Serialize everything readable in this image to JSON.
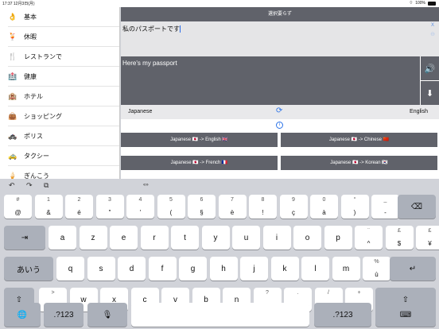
{
  "status": {
    "time": "17:37",
    "date": "12月3日(月)",
    "battery": "100%"
  },
  "sidebar": {
    "items": [
      {
        "icon": "👌",
        "label": "基本"
      },
      {
        "icon": "🍹",
        "label": "休暇"
      },
      {
        "icon": "🍴",
        "label": "レストランで"
      },
      {
        "icon": "🏥",
        "label": "健康"
      },
      {
        "icon": "🏨",
        "label": "ホテル"
      },
      {
        "icon": "👜",
        "label": "ショッピング"
      },
      {
        "icon": "🚓",
        "label": "ポリス"
      },
      {
        "icon": "🚕",
        "label": "タクシー"
      },
      {
        "icon": "🍦",
        "label": "ぎんこう"
      }
    ]
  },
  "main": {
    "title": "選択要らず",
    "input_text": "私のパスポートです",
    "input_close": "X",
    "output_text": "Here's my passport",
    "source_lang": "Japanese",
    "target_lang": "English",
    "pairs": [
      "Japanese 🇯🇵 -> English 🇬🇧",
      "Japanese 🇯🇵 -> Chinese 🇨🇳",
      "Japanese 🇯🇵 -> French 🇫🇷",
      "Japanese 🇯🇵 -> Korean 🇰🇷"
    ]
  },
  "keyboard": {
    "toolbar": {
      "undo": "↶",
      "redo": "↷",
      "paste": "⧉",
      "candidates": "«»"
    },
    "row1": [
      {
        "top": "#",
        "bot": "@"
      },
      {
        "top": "1",
        "bot": "&"
      },
      {
        "top": "2",
        "bot": "é"
      },
      {
        "top": "3",
        "bot": "\""
      },
      {
        "top": "4",
        "bot": "'"
      },
      {
        "top": "5",
        "bot": "("
      },
      {
        "top": "6",
        "bot": "§"
      },
      {
        "top": "7",
        "bot": "è"
      },
      {
        "top": "8",
        "bot": "!"
      },
      {
        "top": "9",
        "bot": "ç"
      },
      {
        "top": "0",
        "bot": "à"
      },
      {
        "top": "°",
        "bot": ")"
      },
      {
        "top": "_",
        "bot": "-"
      }
    ],
    "row2": [
      "a",
      "z",
      "e",
      "r",
      "t",
      "y",
      "u",
      "i",
      "o",
      "p"
    ],
    "row2_extra": [
      {
        "top": "¨",
        "bot": "^"
      },
      {
        "top": "£",
        "bot": "$"
      },
      {
        "top": "£",
        "bot": "¥"
      }
    ],
    "row3": [
      "q",
      "s",
      "d",
      "f",
      "g",
      "h",
      "j",
      "k",
      "l",
      "m"
    ],
    "row3_extra": {
      "top": "%",
      "bot": "ù"
    },
    "row4": [
      {
        "top": ">",
        "bot": "<"
      },
      {
        "main": "w"
      },
      {
        "main": "x"
      },
      {
        "main": "c"
      },
      {
        "main": "v"
      },
      {
        "main": "b"
      },
      {
        "main": "n"
      },
      {
        "top": "?",
        "bot": ","
      },
      {
        "top": ".",
        "bot": ";"
      },
      {
        "top": "/",
        "bot": ":"
      },
      {
        "top": "+",
        "bot": "="
      }
    ],
    "labels": {
      "tab": "⇥",
      "kana": "あいう",
      "shift": "⇧",
      "delete": "⌫",
      "return": "↵",
      "globe": "🌐",
      "num": ".?123",
      "mic": "🎙",
      "hide": "⌨"
    }
  }
}
